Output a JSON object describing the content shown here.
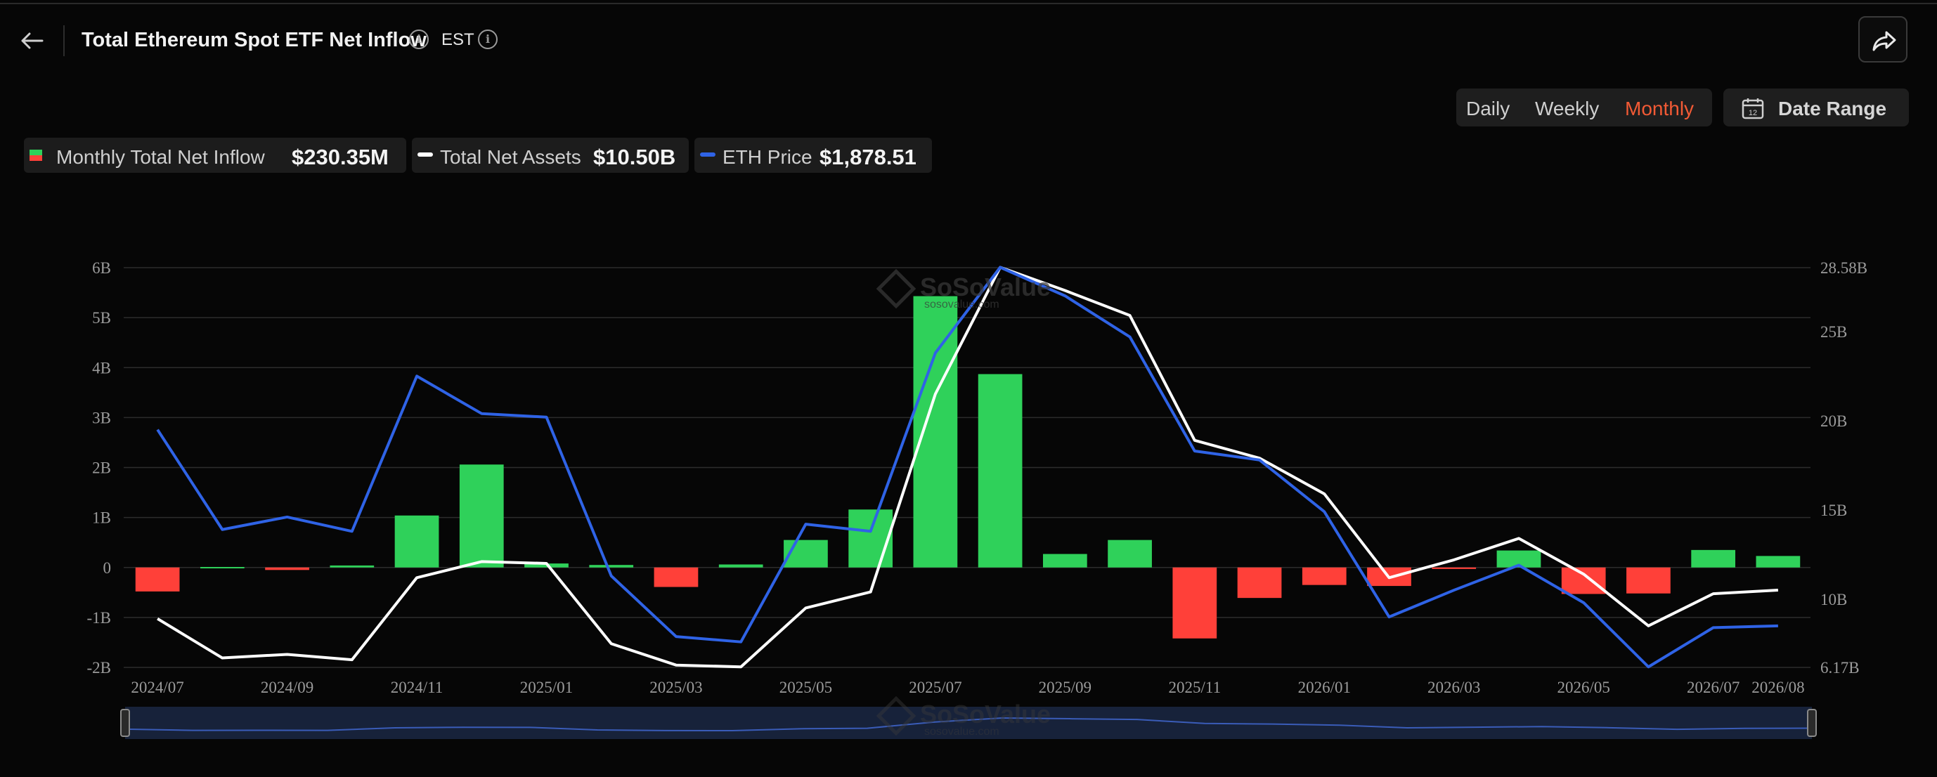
{
  "header": {
    "title": "Total Ethereum Spot ETF Net Inflow",
    "timezone": "EST",
    "info_glyph": "i"
  },
  "controls": {
    "tabs": [
      "Daily",
      "Weekly",
      "Monthly"
    ],
    "active_tab": "Monthly",
    "date_range_label": "Date Range",
    "calendar_day": "12"
  },
  "legend": [
    {
      "label": "Monthly Total Net Inflow",
      "value": "$230.35M"
    },
    {
      "label": "Total Net Assets",
      "value": "$10.50B"
    },
    {
      "label": "ETH Price",
      "value": "$1,878.51"
    }
  ],
  "watermark": {
    "brand": "SoSoValue",
    "domain": "sosovalue.com"
  },
  "colors": {
    "positive": "#2fd15a",
    "negative": "#ff4039",
    "net_assets_line": "#ffffff",
    "eth_price_line": "#2f63e6",
    "accent": "#f25a35"
  },
  "chart_data": {
    "type": "bar",
    "x_tick_labels": [
      "2024/07",
      "2024/09",
      "2024/11",
      "2025/01",
      "2025/03",
      "2025/05",
      "2025/07",
      "2025/09",
      "2025/11",
      "2026/01",
      "2026/03",
      "2026/05",
      "2026/07",
      "2026/08"
    ],
    "y_left_ticks": [
      "6B",
      "5B",
      "4B",
      "3B",
      "2B",
      "1B",
      "0",
      "-1B",
      "-2B"
    ],
    "y_right_ticks": [
      "28.58B",
      "25B",
      "20B",
      "15B",
      "10B",
      "6.17B"
    ],
    "ylim_left": [
      -2,
      6
    ],
    "ylim_right": [
      6.17,
      28.58
    ],
    "grid": true,
    "categories": [
      "2024/07",
      "2024/08",
      "2024/09",
      "2024/10",
      "2024/11",
      "2024/12",
      "2025/01",
      "2025/02",
      "2025/03",
      "2025/04",
      "2025/05",
      "2025/06",
      "2025/07",
      "2025/08",
      "2025/09",
      "2025/10",
      "2025/11",
      "2025/12",
      "2026/01",
      "2026/02",
      "2026/03",
      "2026/04",
      "2026/05",
      "2026/06",
      "2026/07",
      "2026/08"
    ],
    "series": [
      {
        "name": "Monthly Total Net Inflow",
        "type": "bar",
        "unit": "B",
        "values": [
          -0.48,
          0.01,
          -0.05,
          0.04,
          1.04,
          2.06,
          0.08,
          0.05,
          -0.39,
          0.06,
          0.55,
          1.16,
          5.43,
          3.87,
          0.27,
          0.55,
          -1.42,
          -0.61,
          -0.35,
          -0.37,
          -0.03,
          0.34,
          -0.53,
          -0.52,
          0.35,
          0.23
        ]
      },
      {
        "name": "Total Net Assets",
        "type": "line",
        "unit": "B",
        "values": [
          8.9,
          6.7,
          6.9,
          6.6,
          11.2,
          12.1,
          12.0,
          7.5,
          6.3,
          6.2,
          9.5,
          10.4,
          21.5,
          28.6,
          27.3,
          25.9,
          18.9,
          17.9,
          15.9,
          11.2,
          12.2,
          13.4,
          11.4,
          8.5,
          10.3,
          10.5
        ]
      },
      {
        "name": "ETH Price",
        "type": "line",
        "values": [
          19.5,
          13.9,
          14.6,
          13.8,
          22.5,
          20.4,
          20.2,
          11.3,
          7.9,
          7.6,
          14.2,
          13.8,
          23.8,
          28.6,
          27.0,
          24.7,
          18.3,
          17.8,
          14.9,
          9.0,
          10.5,
          11.9,
          9.8,
          6.2,
          8.4,
          8.5
        ]
      }
    ]
  }
}
